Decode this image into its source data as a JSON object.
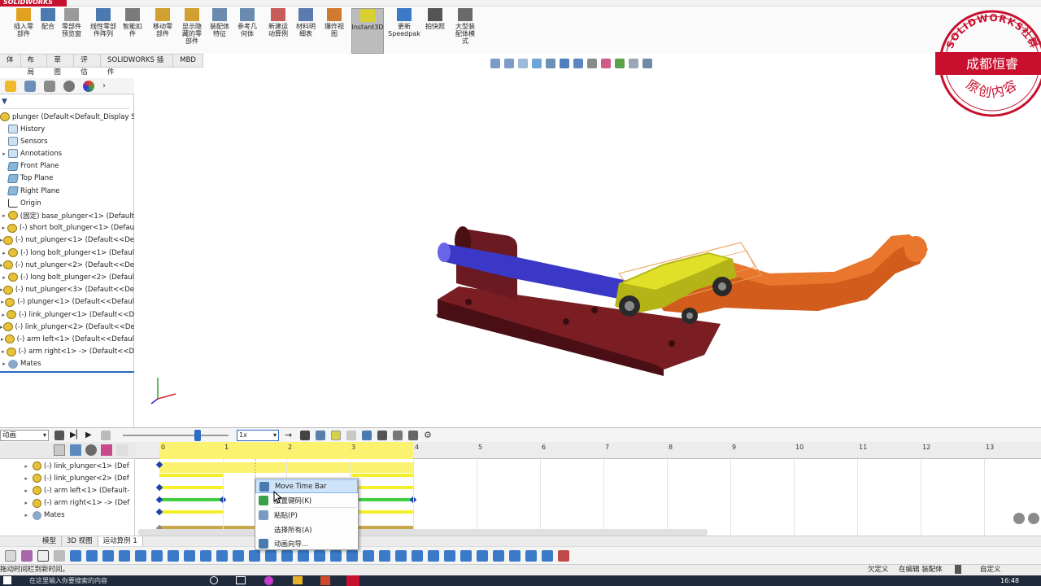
{
  "app": {
    "logo": "SOLIDWORKS"
  },
  "ribbon": {
    "items": [
      {
        "label": "插入零\n部件"
      },
      {
        "label": "配合"
      },
      {
        "label": "零部件\n预览窗"
      },
      {
        "label": "线性零部\n件阵列"
      },
      {
        "label": "智能扣\n件"
      },
      {
        "label": "移动零\n部件"
      },
      {
        "label": "显示隐\n藏的零\n部件"
      },
      {
        "label": "装配体\n特征"
      },
      {
        "label": "参考几\n何体"
      },
      {
        "label": "新建运\n动算例"
      },
      {
        "label": "材料明\n细表"
      },
      {
        "label": "爆炸视\n图"
      },
      {
        "label": "Instant3D"
      },
      {
        "label": "更新\nSpeedpak"
      },
      {
        "label": "拍快照"
      },
      {
        "label": "大型装\n配体模\n式"
      }
    ]
  },
  "command_tabs": [
    "体",
    "布局",
    "草图",
    "评估",
    "SOLIDWORKS 插件",
    "MBD"
  ],
  "feature_tree": {
    "filter_icon": "filter-icon",
    "root": "plunger  (Default<Default_Display St",
    "items": [
      {
        "label": "History",
        "icon": "folder",
        "arrow": ""
      },
      {
        "label": "Sensors",
        "icon": "folder",
        "arrow": ""
      },
      {
        "label": "Annotations",
        "icon": "folder",
        "arrow": "▸"
      },
      {
        "label": "Front Plane",
        "icon": "plane",
        "arrow": ""
      },
      {
        "label": "Top Plane",
        "icon": "plane",
        "arrow": ""
      },
      {
        "label": "Right Plane",
        "icon": "plane",
        "arrow": ""
      },
      {
        "label": "Origin",
        "icon": "origin",
        "arrow": ""
      },
      {
        "label": "(固定) base_plunger<1> (Default",
        "icon": "gear",
        "arrow": "▸"
      },
      {
        "label": "(-) short bolt_plunger<1> (Defau",
        "icon": "gear",
        "arrow": "▸"
      },
      {
        "label": "(-) nut_plunger<1> (Default<<De",
        "icon": "gear",
        "arrow": "▸"
      },
      {
        "label": "(-) long bolt_plunger<1> (Defaul",
        "icon": "gear",
        "arrow": "▸"
      },
      {
        "label": "(-) nut_plunger<2> (Default<<De",
        "icon": "gear",
        "arrow": "▸"
      },
      {
        "label": "(-) long bolt_plunger<2> (Defaul",
        "icon": "gear",
        "arrow": "▸"
      },
      {
        "label": "(-) nut_plunger<3> (Default<<De",
        "icon": "gear",
        "arrow": "▸"
      },
      {
        "label": "(-) plunger<1> (Default<<Defaul",
        "icon": "gear",
        "arrow": "▸"
      },
      {
        "label": "(-) link_plunger<1> (Default<<D",
        "icon": "gear",
        "arrow": "▸"
      },
      {
        "label": "(-) link_plunger<2> (Default<<De",
        "icon": "gear",
        "arrow": "▸"
      },
      {
        "label": "(-) arm left<1> (Default<<Defaul",
        "icon": "gear",
        "arrow": "▸"
      },
      {
        "label": "(-) arm right<1> -> (Default<<D",
        "icon": "gear",
        "arrow": "▸"
      },
      {
        "label": "Mates",
        "icon": "mates",
        "arrow": "▸"
      }
    ]
  },
  "watermark": {
    "top_text": "SOLIDWORKS社群",
    "banner": "成都恒睿",
    "bottom_text": "原创内容"
  },
  "motion": {
    "study_type": "动画",
    "speed": "1x",
    "ticks": [
      "0",
      "1",
      "2",
      "3",
      "4",
      "5",
      "6",
      "7",
      "8",
      "9",
      "10",
      "11",
      "12",
      "13"
    ],
    "rows": [
      {
        "label": "(-) link_plunger<1> (Def"
      },
      {
        "label": "(-) link_plunger<2> (Def"
      },
      {
        "label": "(-) arm left<1> (Default-"
      },
      {
        "label": "(-) arm right<1> -> (Def"
      },
      {
        "label": "Mates"
      }
    ]
  },
  "context_menu": {
    "items": [
      {
        "label": "Move Time Bar",
        "highlight": true
      },
      {
        "label": "放置键码(K)"
      },
      {
        "label": "粘贴(P)"
      },
      {
        "label": "选择所有(A)"
      },
      {
        "label": "动画向导..."
      }
    ]
  },
  "bottom_tabs": [
    "模型",
    "3D 视图",
    "运动算例 1"
  ],
  "status": {
    "left": "拖动时间栏到新时间。",
    "undefined": "欠定义",
    "editing": "在编辑 装配体",
    "custom": "自定义"
  },
  "taskbar": {
    "search": "在这里输入你要搜索的内容",
    "time": "16:48"
  },
  "colors": {
    "brand_red": "#c8102e",
    "keyframe_blue": "#1e3fb0",
    "timeline_yellow": "#fbf36f",
    "change_bar_green": "#3fcf3f",
    "mates_bar": "#c8a84a"
  }
}
